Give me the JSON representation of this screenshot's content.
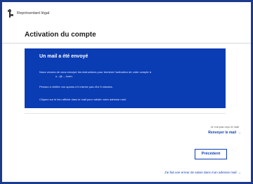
{
  "header": {
    "brand": "Représentant légal"
  },
  "page": {
    "title": "Activation du compte"
  },
  "notice": {
    "title": "Un mail a été envoyé",
    "line1": "Nous venons de vous envoyer les instructions pour terminer l'activation de votre compte à",
    "line1_email": "u...@.....lcom.",
    "line2": "Pensez à vérifier vos spams s'il n'arrive pas d'ici 5 minutes.",
    "line3": "Cliquez sur le lien affiché dans le mail pour valider votre adresse mail."
  },
  "actions": {
    "not_received": "Je n'ai pas reçu le mail",
    "resend_label": "Renvoyer le mail",
    "previous_label": "Précédent",
    "error_link_label": "J'ai fait une erreur de saisie dans mon adresse mail",
    "arrow": "→"
  },
  "colors": {
    "primary": "#0a3cb4",
    "frame_border": "#1b3b8a"
  }
}
